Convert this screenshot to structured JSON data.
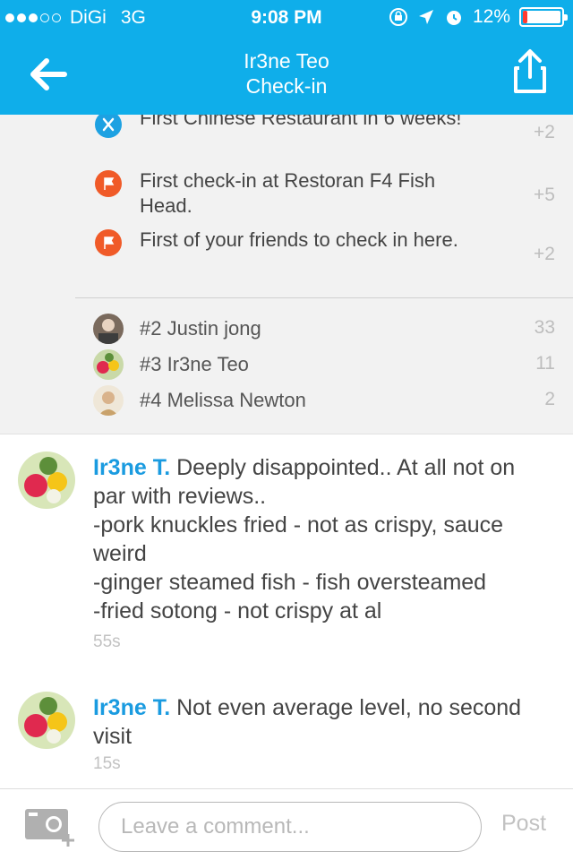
{
  "status_bar": {
    "carrier": "DiGi",
    "network": "3G",
    "time": "9:08 PM",
    "battery_percent": "12%",
    "battery_level": 0.12
  },
  "nav": {
    "title_line1": "Ir3ne Teo",
    "title_line2": "Check-in"
  },
  "bonuses": [
    {
      "icon": "fork-knife-icon",
      "color": "#1da1e2",
      "text": "First Chinese Restaurant in 6 weeks!",
      "points": "+2"
    },
    {
      "icon": "flag-icon",
      "color": "#f05a28",
      "text": "First check-in at Restoran F4 Fish Head.",
      "points": "+5"
    },
    {
      "icon": "flag-icon",
      "color": "#f05a28",
      "text": "First of your friends to check in here.",
      "points": "+2"
    }
  ],
  "leaderboard": [
    {
      "name": "#2 Justin jong",
      "score": "33"
    },
    {
      "name": "#3 Ir3ne Teo",
      "score": "11"
    },
    {
      "name": "#4 Melissa Newton",
      "score": "2"
    }
  ],
  "comments": [
    {
      "author": "Ir3ne T.",
      "text": " Deeply disappointed.. At all not on par with reviews..\n-pork knuckles fried - not as crispy, sauce weird\n-ginger steamed fish - fish oversteamed\n-fried sotong - not crispy at al",
      "time": "55s"
    },
    {
      "author": "Ir3ne T.",
      "text": " Not even average level, no second visit",
      "time": "15s"
    }
  ],
  "composer": {
    "placeholder": "Leave a comment...",
    "post_label": "Post"
  },
  "colors": {
    "accent": "#0faeea",
    "link": "#1a9be0",
    "panel": "#f2f2f2"
  }
}
